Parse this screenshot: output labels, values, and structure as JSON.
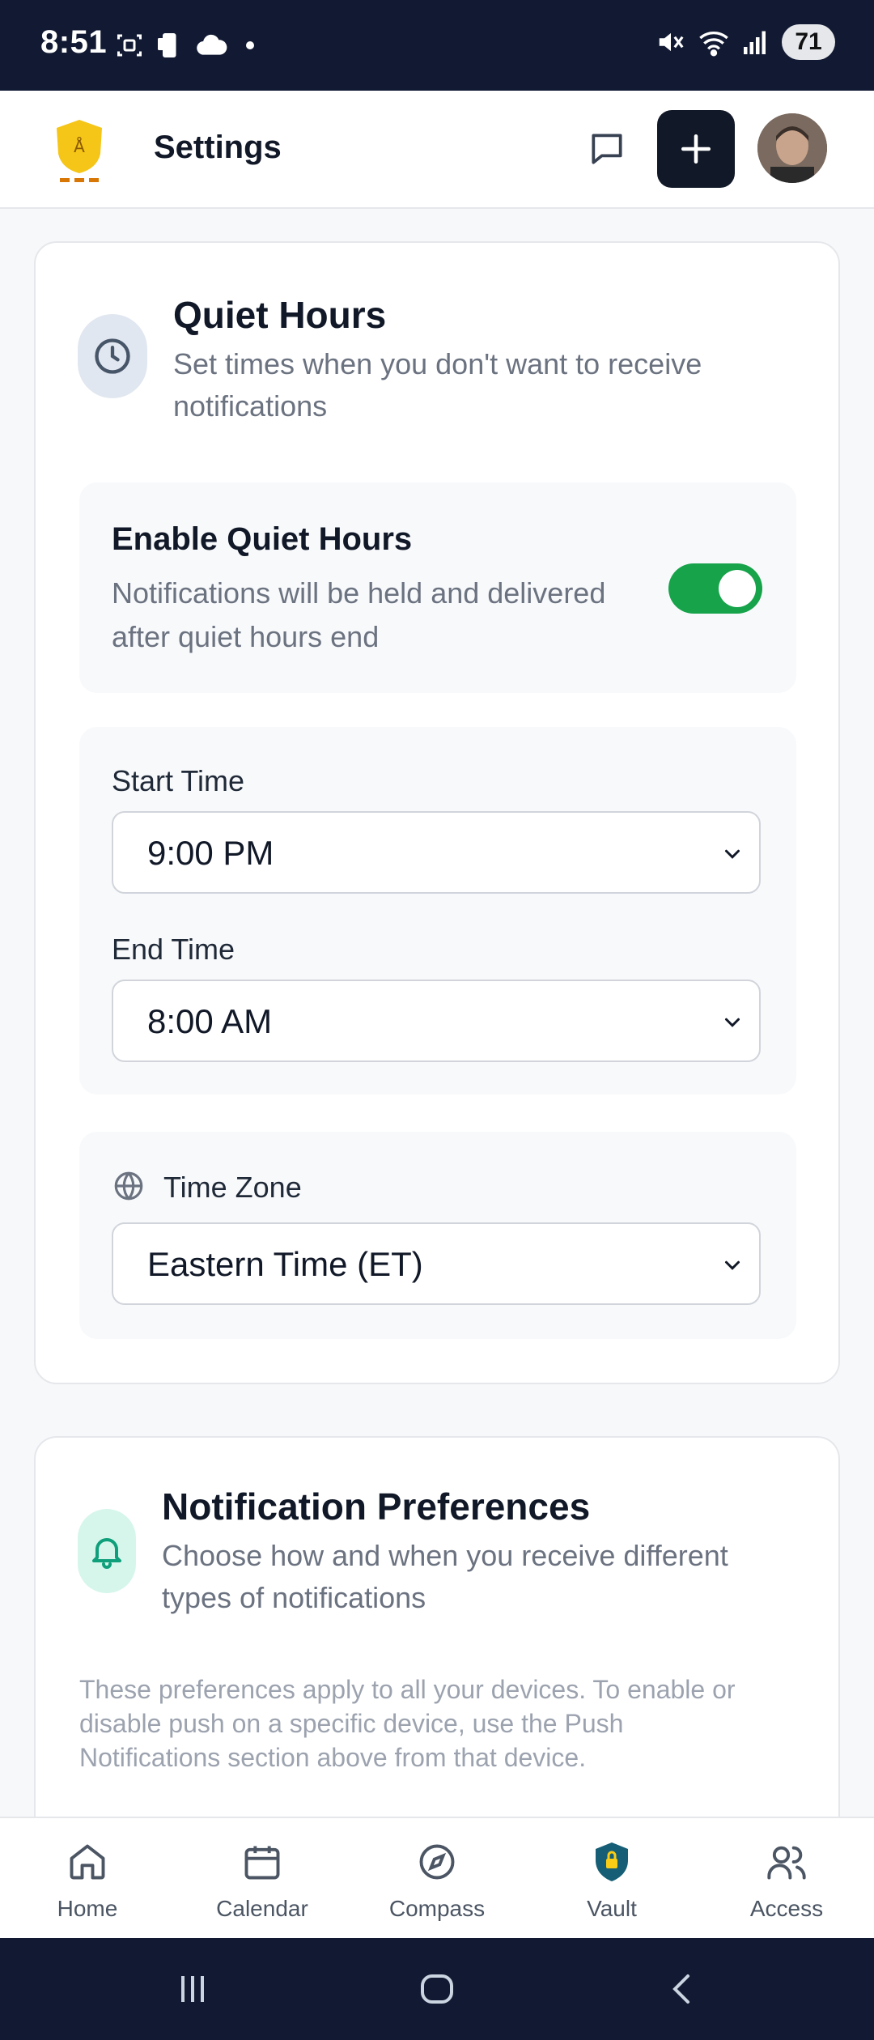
{
  "status_bar": {
    "time": "8:51",
    "battery": "71"
  },
  "header": {
    "title": "Settings"
  },
  "quiet_hours": {
    "title": "Quiet Hours",
    "subtitle_line1": "Set times when you don't want to receive",
    "subtitle_line2": "notifications",
    "enable_label": "Enable Quiet Hours",
    "enable_desc_line1": "Notifications will be held and delivered",
    "enable_desc_line2": "after quiet hours end",
    "enabled": true,
    "start_label": "Start Time",
    "start_value": "9:00 PM",
    "end_label": "End Time",
    "end_value": "8:00 AM",
    "tz_label": "Time Zone",
    "tz_value": "Eastern Time (ET)"
  },
  "notification_prefs": {
    "title": "Notification Preferences",
    "subtitle_line1": "Choose how and when you receive different",
    "subtitle_line2": "types of notifications",
    "note_line1": "These preferences apply to all your devices. To enable or",
    "note_line2": "disable push on a specific device, use the Push",
    "note_line3": "Notifications section above from that device."
  },
  "bottom_nav": {
    "items": [
      {
        "label": "Home",
        "icon": "home-icon"
      },
      {
        "label": "Calendar",
        "icon": "calendar-icon"
      },
      {
        "label": "Compass",
        "icon": "compass-icon"
      },
      {
        "label": "Vault",
        "icon": "vault-shield-icon"
      },
      {
        "label": "Access",
        "icon": "users-icon"
      }
    ]
  },
  "colors": {
    "accent_green": "#16a34a",
    "dark": "#111827",
    "status_bar": "#121a33"
  }
}
